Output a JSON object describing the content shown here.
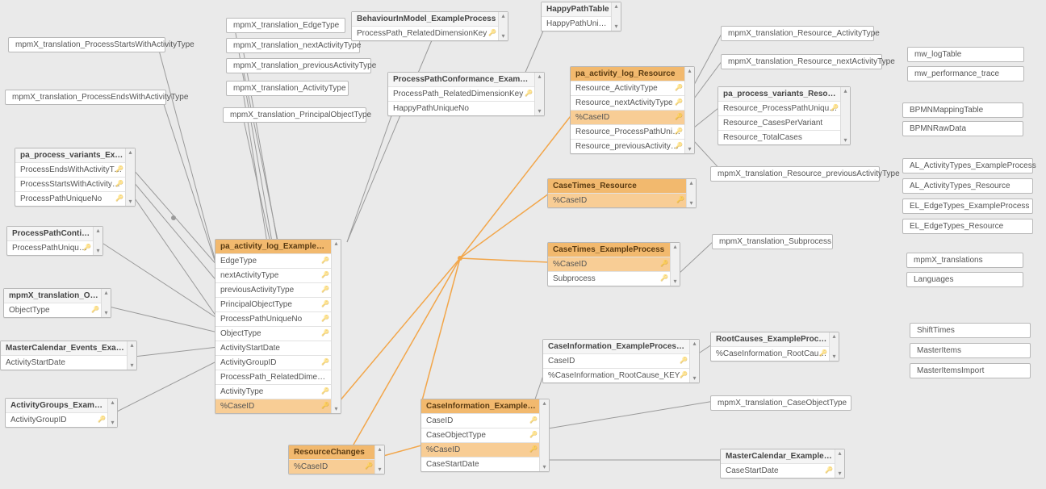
{
  "tables": {
    "pa_process_variants_ExampleProcess": {
      "title": "pa_process_variants_ExampleProcess",
      "fields": [
        "ProcessEndsWithActivityType",
        "ProcessStartsWithActivityType",
        "ProcessPathUniqueNo"
      ],
      "keys": [
        0,
        1,
        2
      ],
      "hl": false
    },
    "ProcessPathContinuation": {
      "title": "ProcessPathContinuation",
      "fields": [
        "ProcessPathUniqueNo"
      ],
      "keys": [
        0
      ]
    },
    "mpmX_translation_ObjectType": {
      "title": "mpmX_translation_ObjectType",
      "fields": [
        "ObjectType"
      ],
      "keys": [
        0
      ]
    },
    "MasterCalendar_Events_ExampleProcess": {
      "title": "MasterCalendar_Events_ExampleProcess",
      "fields": [
        "ActivityStartDate"
      ]
    },
    "ActivityGroups_ExampleProcess": {
      "title": "ActivityGroups_ExampleProcess",
      "fields": [
        "ActivityGroupID"
      ],
      "keys": [
        0
      ]
    },
    "BehaviourInModel_ExampleProcess": {
      "title": "BehaviourInModel_ExampleProcess",
      "fields": [
        "ProcessPath_RelatedDimensionKey"
      ],
      "keys": [
        0
      ]
    },
    "ProcessPathConformance_ExampleProcess": {
      "title": "ProcessPathConformance_ExampleProcess",
      "fields": [
        "ProcessPath_RelatedDimensionKey",
        "HappyPathUniqueNo"
      ],
      "keys": [
        0
      ]
    },
    "HappyPathTable": {
      "title": "HappyPathTable",
      "fields": [
        "HappyPathUniqueN..."
      ]
    },
    "pa_activity_log_ExampleProcess": {
      "title": "pa_activity_log_ExampleProcess",
      "fields": [
        "EdgeType",
        "nextActivityType",
        "previousActivityType",
        "PrincipalObjectType",
        "ProcessPathUniqueNo",
        "ObjectType",
        "ActivityStartDate",
        "ActivityGroupID",
        "ProcessPath_RelatedDimensionK...",
        "ActivityType",
        "%CaseID"
      ],
      "keys": [
        0,
        1,
        2,
        3,
        4,
        5,
        7,
        9,
        10
      ],
      "hl": true,
      "hlRows": [
        10
      ]
    },
    "ResourceChanges": {
      "title": "ResourceChanges",
      "fields": [
        "%CaseID"
      ],
      "keys": [
        0
      ],
      "hl": true,
      "hlRows": [
        0
      ]
    },
    "CaseInformation_ExampleProcess": {
      "title": "CaseInformation_ExampleProcess",
      "fields": [
        "CaseID",
        "CaseObjectType",
        "%CaseID",
        "CaseStartDate"
      ],
      "keys": [
        0,
        1,
        2
      ],
      "hl": true,
      "hlRows": [
        2
      ]
    },
    "pa_activity_log_Resource": {
      "title": "pa_activity_log_Resource",
      "fields": [
        "Resource_ActivityType",
        "Resource_nextActivityType",
        "%CaseID",
        "Resource_ProcessPathUniqueNo",
        "Resource_previousActivityType"
      ],
      "keys": [
        0,
        1,
        2,
        3,
        4
      ],
      "hl": true,
      "hlRows": [
        2
      ]
    },
    "CaseTimes_Resource": {
      "title": "CaseTimes_Resource",
      "fields": [
        "%CaseID"
      ],
      "keys": [
        0
      ],
      "hl": true,
      "hlRows": [
        0
      ]
    },
    "CaseTimes_ExampleProcess": {
      "title": "CaseTimes_ExampleProcess",
      "fields": [
        "%CaseID",
        "Subprocess"
      ],
      "keys": [
        0,
        1
      ],
      "hl": true,
      "hlRows": [
        0
      ]
    },
    "CaseInformation_ExampleProcess_RCA_LinkTable": {
      "title": "CaseInformation_ExampleProcess_RCA_LinkTable",
      "fields": [
        "CaseID",
        "%CaseInformation_RootCause_KEY"
      ],
      "keys": [
        0,
        1
      ]
    },
    "RootCauses_ExampleProcess": {
      "title": "RootCauses_ExampleProcess",
      "fields": [
        "%CaseInformation_RootCause_K..."
      ],
      "keys": [
        0
      ]
    },
    "pa_process_variants_Resource": {
      "title": "pa_process_variants_Resource",
      "fields": [
        "Resource_ProcessPathUniqueNo",
        "Resource_CasesPerVariant",
        "Resource_TotalCases"
      ],
      "keys": [
        0
      ]
    },
    "MasterCalendar_ExampleProcess": {
      "title": "MasterCalendar_ExampleProcess",
      "fields": [
        "CaseStartDate"
      ],
      "keys": [
        0
      ]
    }
  },
  "chips": {
    "c1": "mpmX_translation_ProcessStartsWithActivityType",
    "c2": "mpmX_translation_ProcessEndsWithActivityType",
    "c3": "mpmX_translation_EdgeType",
    "c4": "mpmX_translation_nextActivityType",
    "c5": "mpmX_translation_previousActivityType",
    "c6": "mpmX_translation_ActivityType",
    "c7": "mpmX_translation_PrincipalObjectType",
    "c8": "mpmX_translation_Resource_ActivityType",
    "c9": "mpmX_translation_Resource_nextActivityType",
    "c10": "mpmX_translation_Resource_previousActivityType",
    "c11": "mpmX_translation_Subprocess",
    "c12": "mpmX_translation_CaseObjectType",
    "r1": "mw_logTable",
    "r2": "mw_performance_trace",
    "r3": "BPMNMappingTable",
    "r4": "BPMNRawData",
    "r5": "AL_ActivityTypes_ExampleProcess",
    "r6": "AL_ActivityTypes_Resource",
    "r7": "EL_EdgeTypes_ExampleProcess",
    "r8": "EL_EdgeTypes_Resource",
    "r9": "mpmX_translations",
    "r10": "Languages",
    "r11": "ShiftTimes",
    "r12": "MasterItems",
    "r13": "MasterItemsImport"
  }
}
